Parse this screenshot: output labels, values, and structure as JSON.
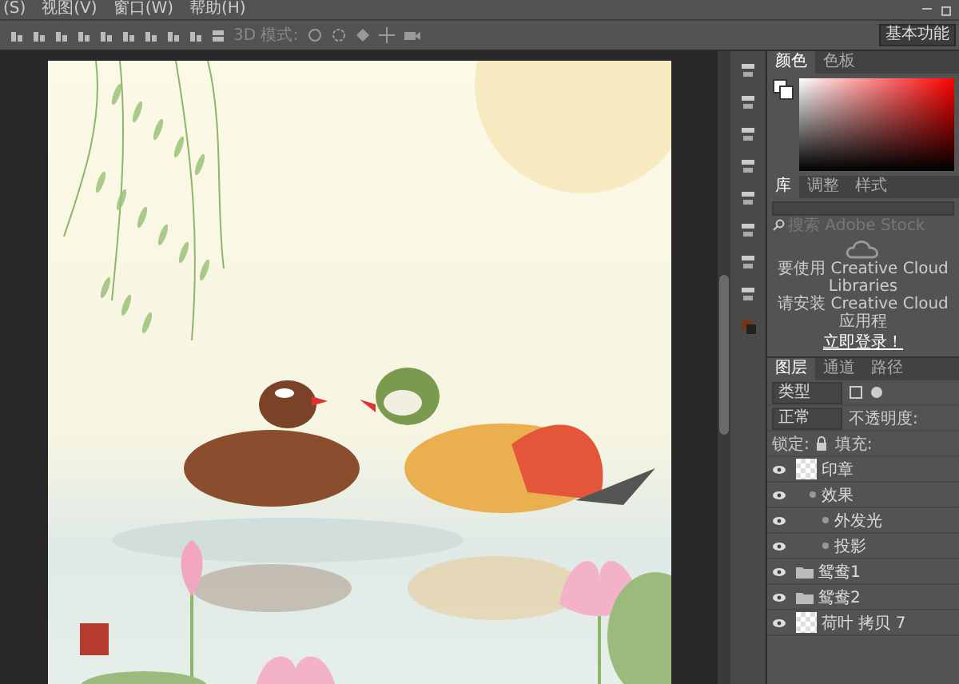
{
  "menu": [
    "(S)",
    "视图(V)",
    "窗口(W)",
    "帮助(H)"
  ],
  "options_bar": {
    "mode_label": "3D 模式:",
    "workspace": "基本功能"
  },
  "color_panel": {
    "tabs": [
      {
        "label": "颜色",
        "selected": true
      },
      {
        "label": "色板",
        "selected": false
      }
    ]
  },
  "library_panel": {
    "tabs": [
      {
        "label": "库",
        "selected": true
      },
      {
        "label": "调整",
        "selected": false
      },
      {
        "label": "样式",
        "selected": false
      }
    ],
    "search_placeholder": "搜索 Adobe Stock",
    "message": [
      "要使用 Creative Cloud Libraries",
      "请安装 Creative Cloud 应用程"
    ],
    "link": "立即登录！"
  },
  "layers_panel": {
    "tabs": [
      {
        "label": "图层",
        "selected": true
      },
      {
        "label": "通道",
        "selected": false
      },
      {
        "label": "路径",
        "selected": false
      }
    ],
    "filter": "类型",
    "blend_mode": "正常",
    "opacity_label": "不透明度:",
    "lock_label": "锁定:",
    "fill_label": "填充:",
    "layers": [
      {
        "kind": "layer",
        "name": "印章",
        "visible": true,
        "children": [
          {
            "kind": "effect",
            "name": "效果",
            "visible": true,
            "children": [
              {
                "kind": "effect",
                "name": "外发光",
                "visible": true
              },
              {
                "kind": "effect",
                "name": "投影",
                "visible": true
              }
            ]
          }
        ]
      },
      {
        "kind": "group",
        "name": "鸳鸯1",
        "visible": true
      },
      {
        "kind": "group",
        "name": "鸳鸯2",
        "visible": true
      },
      {
        "kind": "layer",
        "name": "荷叶 拷贝 7",
        "visible": true
      }
    ]
  }
}
